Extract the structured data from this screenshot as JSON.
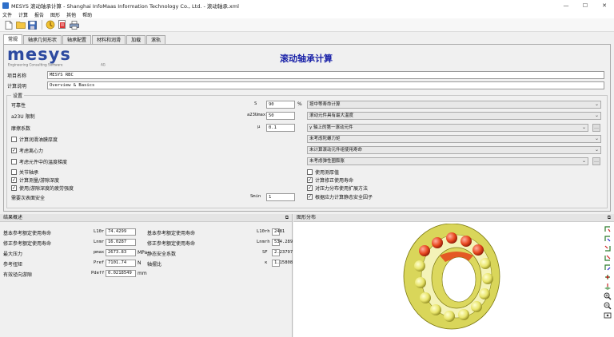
{
  "window": {
    "title": "MESYS 滚动轴承计算 - Shanghai InfoMaas Information Technology Co., Ltd. - 滚动轴承.xml"
  },
  "menu": [
    "文件",
    "计算",
    "报告",
    "图形",
    "其他",
    "帮助"
  ],
  "tabs": [
    "常规",
    "轴承几何形状",
    "轴承配置",
    "材料和润滑",
    "加载",
    "滚轨"
  ],
  "header": {
    "logo_text": "mesys",
    "logo_tagline": "Engineering Consulting Software",
    "logo_ag": "AG",
    "page_title": "滚动轴承计算"
  },
  "project": {
    "name_label": "项目名称",
    "name_value": "MESYS RBC",
    "desc_label": "计算说明",
    "desc_value": "Overview & Basics"
  },
  "settings": {
    "group_title": "设置",
    "rows": [
      {
        "label": "可靠性",
        "sym": "S",
        "value": "90",
        "unit": "%",
        "combo": "按中等寿命计算"
      },
      {
        "label": "a23U 限制",
        "sym": "a23Umax",
        "value": "50",
        "unit": "",
        "combo": "滚动元件具有最大温度"
      },
      {
        "label": "摩擦系数",
        "sym": "μ",
        "value": "0.1",
        "unit": "",
        "combo": "y 轴上的第一滚动元件"
      }
    ],
    "right_combos": [
      "未考虑陀螺力矩",
      "未计算滚动元件组使用寿命",
      "未考虑弹性圈膨胀"
    ],
    "left_checks": [
      {
        "label": "计算润滑油膜厚度",
        "checked": false
      },
      {
        "label": "考虑离心力",
        "checked": true
      },
      {
        "label": "考虑元件中的温度梯度",
        "checked": false
      },
      {
        "label": "关节轴承",
        "checked": false
      },
      {
        "label": "计算测量/游隙深度",
        "checked": true
      },
      {
        "label": "使用/游隙深度的疲劳强度",
        "checked": true
      }
    ],
    "right_checks": [
      {
        "label": "使用测厚值",
        "checked": false
      },
      {
        "label": "计算修正使用寿命",
        "checked": true
      },
      {
        "label": "对压力分布使用扩展方法",
        "checked": true
      },
      {
        "label": "根据应力计算静态安全因子",
        "checked": true
      }
    ],
    "smin": {
      "label": "需要次表面安全",
      "sym": "Smin",
      "value": "1"
    }
  },
  "results": {
    "title": "结果概述",
    "left": [
      {
        "label": "基本参考额定使用寿命",
        "sym": "L10r",
        "value": "74.4299",
        "unit": ""
      },
      {
        "label": "修正参考额定使用寿命",
        "sym": "Lnmr",
        "value": "16.0287",
        "unit": ""
      },
      {
        "label": "最大压力",
        "sym": "pmax",
        "value": "2673.83",
        "unit": "MPa"
      },
      {
        "label": "参考扭矩",
        "sym": "Pref",
        "value": "7101.74",
        "unit": "N"
      },
      {
        "label": "有效径向游隙",
        "sym": "Pdeff",
        "value": "0.0218549",
        "unit": "mm"
      }
    ],
    "right": [
      {
        "label": "基本参考额定使用寿命",
        "sym": "L10rh",
        "value": "2481",
        "unit": "h"
      },
      {
        "label": "修正参考额定使用寿命",
        "sym": "Lnmrh",
        "value": "534.289",
        "unit": "h"
      },
      {
        "label": "静态安全系数",
        "sym": "SF",
        "value": "2.23797",
        "unit": ""
      },
      {
        "label": "轴摆比",
        "sym": "κ",
        "value": "1.15808",
        "unit": ""
      }
    ]
  },
  "pressure": {
    "title": "图形分布"
  }
}
